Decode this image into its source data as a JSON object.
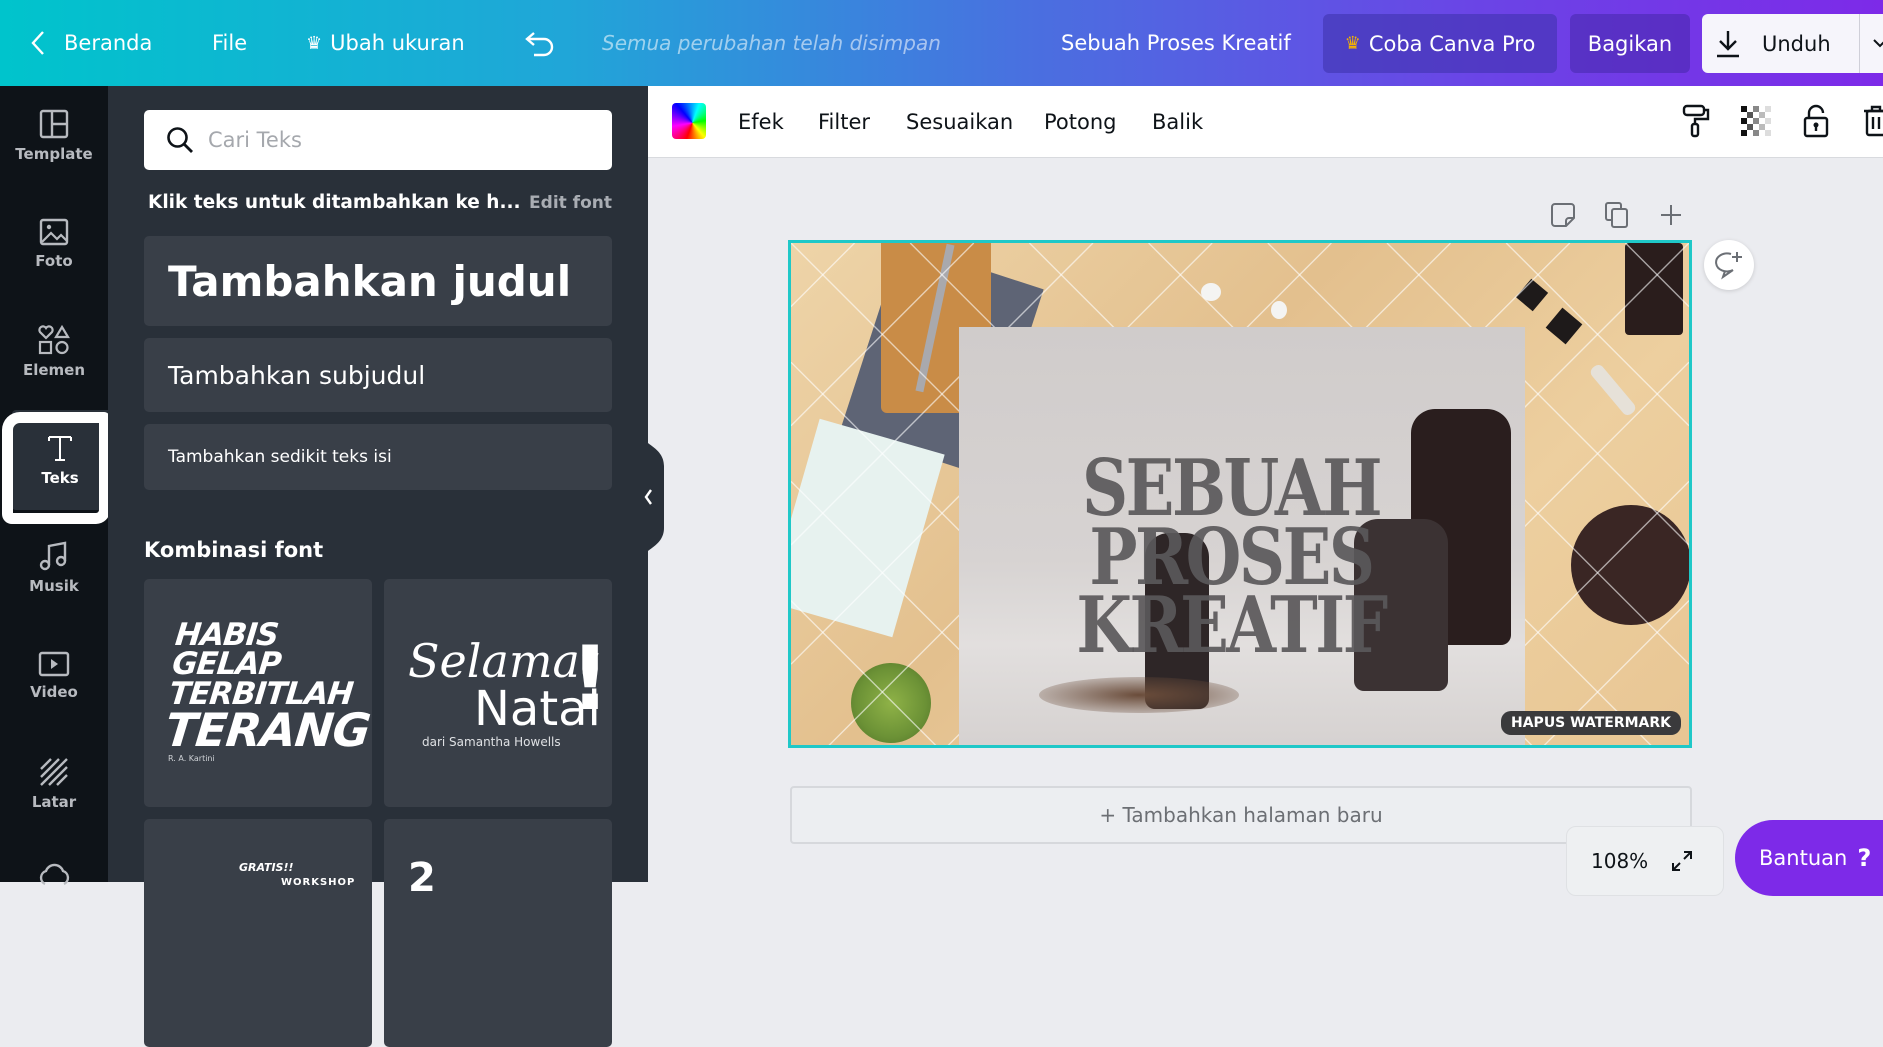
{
  "header": {
    "home_label": "Beranda",
    "file_label": "File",
    "resize_label": "Ubah ukuran",
    "save_status": "Semua perubahan telah disimpan",
    "document_title": "Sebuah Proses Kreatif",
    "try_pro_label": "Coba Canva Pro",
    "share_label": "Bagikan",
    "download_label": "Unduh",
    "gradient_colors": [
      "#00c4cc",
      "#7d2ae8"
    ]
  },
  "sidebar": {
    "items": [
      {
        "label": "Template",
        "icon": "template-icon"
      },
      {
        "label": "Foto",
        "icon": "photo-icon"
      },
      {
        "label": "Elemen",
        "icon": "elements-icon"
      },
      {
        "label": "Teks",
        "icon": "text-icon",
        "active": true
      },
      {
        "label": "Musik",
        "icon": "music-icon"
      },
      {
        "label": "Video",
        "icon": "video-icon"
      },
      {
        "label": "Latar",
        "icon": "background-icon"
      },
      {
        "label": "",
        "icon": "upload-cloud-icon"
      }
    ]
  },
  "panel": {
    "search_placeholder": "Cari Teks",
    "hint": "Klik teks untuk ditambahkan ke h...",
    "edit_font_label": "Edit font",
    "add_heading": "Tambahkan judul",
    "add_subheading": "Tambahkan subjudul",
    "add_body": "Tambahkan sedikit teks isi",
    "combinations_title": "Kombinasi font",
    "combinations": [
      {
        "lines": [
          "HABIS GELAP",
          "TERBITLAH",
          "TERANG"
        ],
        "sub": "R. A. Kartini"
      },
      {
        "lines": [
          "Selamat",
          "Natal",
          "!"
        ],
        "sub": "dari Samantha Howells"
      },
      {
        "lines": [
          "GRATIS!!",
          "WORKSHOP"
        ],
        "sub": ""
      },
      {
        "lines": [
          "2"
        ],
        "sub": ""
      }
    ]
  },
  "toolbar": {
    "effects_label": "Efek",
    "filter_label": "Filter",
    "adjust_label": "Sesuaikan",
    "crop_label": "Potong",
    "flip_label": "Balik",
    "right_icons": [
      "paint-roller-icon",
      "transparency-icon",
      "unlock-icon",
      "trash-icon"
    ]
  },
  "canvas": {
    "headline_lines": [
      "SEBUAH",
      "PROSES",
      "KREATIF"
    ],
    "watermark_label": "HAPUS WATERMARK",
    "add_page_label": "+ Tambahkan halaman baru",
    "zoom_level": "108%",
    "help_label": "Bantuan",
    "help_symbol": "?",
    "selection_color": "#1fc8c8"
  }
}
